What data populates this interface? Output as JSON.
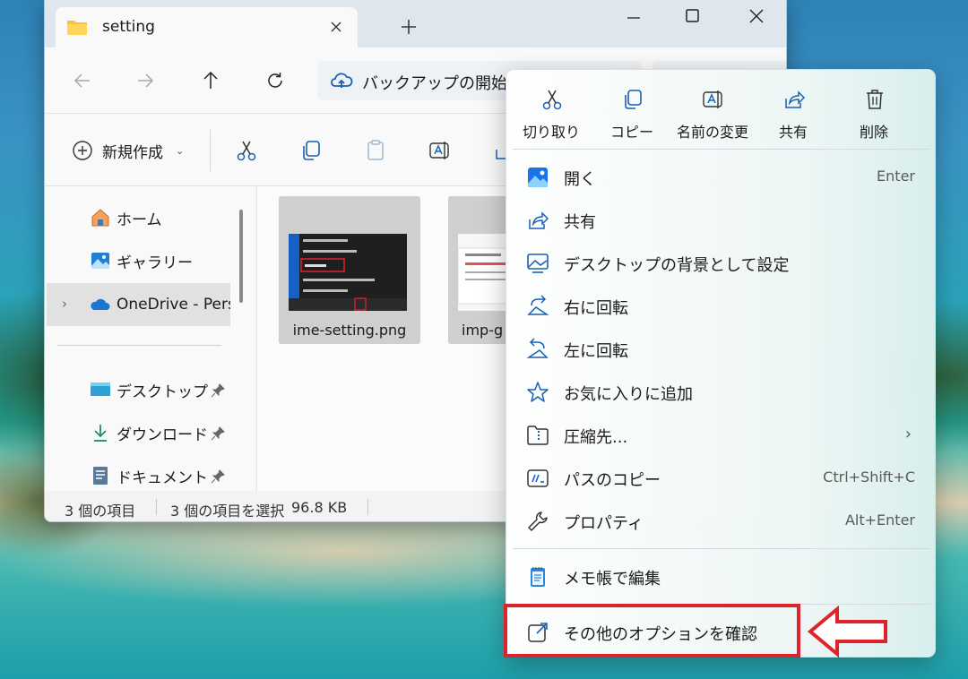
{
  "window": {
    "tab_title": "setting",
    "address": "バックアップの開始"
  },
  "toolbar": {
    "new_label": "新規作成"
  },
  "sidebar": {
    "items": [
      {
        "label": "ホーム",
        "icon": "home-icon"
      },
      {
        "label": "ギャラリー",
        "icon": "gallery-icon"
      },
      {
        "label": "OneDrive - Perso",
        "icon": "onedrive-cloud-icon"
      },
      {
        "label": "デスクトップ",
        "icon": "desktop-folder-icon",
        "pinned": true
      },
      {
        "label": "ダウンロード",
        "icon": "download-icon",
        "pinned": true
      },
      {
        "label": "ドキュメント",
        "icon": "documents-icon",
        "pinned": true
      }
    ]
  },
  "files": [
    {
      "name": "ime-setting.png",
      "selected": true
    },
    {
      "name": "imp-g",
      "selected": true
    }
  ],
  "status": {
    "count": "3 個の項目",
    "selection": "3 個の項目を選択",
    "size": "96.8 KB"
  },
  "context_menu": {
    "quick_actions": [
      {
        "label": "切り取り",
        "icon": "cut-icon"
      },
      {
        "label": "コピー",
        "icon": "copy-icon"
      },
      {
        "label": "名前の変更",
        "icon": "rename-icon"
      },
      {
        "label": "共有",
        "icon": "share-icon"
      },
      {
        "label": "削除",
        "icon": "delete-icon"
      }
    ],
    "items": [
      {
        "label": "開く",
        "shortcut": "Enter",
        "icon": "photos-app-icon"
      },
      {
        "label": "共有",
        "shortcut": "",
        "icon": "share-icon"
      },
      {
        "label": "デスクトップの背景として設定",
        "shortcut": "",
        "icon": "wallpaper-icon"
      },
      {
        "label": "右に回転",
        "shortcut": "",
        "icon": "rotate-right-icon"
      },
      {
        "label": "左に回転",
        "shortcut": "",
        "icon": "rotate-left-icon"
      },
      {
        "label": "お気に入りに追加",
        "shortcut": "",
        "icon": "star-icon"
      },
      {
        "label": "圧縮先...",
        "shortcut": "",
        "icon": "zip-folder-icon",
        "submenu": true
      },
      {
        "label": "パスのコピー",
        "shortcut": "Ctrl+Shift+C",
        "icon": "copy-path-icon"
      },
      {
        "label": "プロパティ",
        "shortcut": "Alt+Enter",
        "icon": "wrench-icon"
      },
      {
        "label": "メモ帳で編集",
        "shortcut": "",
        "icon": "notepad-icon"
      },
      {
        "label": "その他のオプションを確認",
        "shortcut": "",
        "icon": "more-options-icon",
        "highlighted": true
      }
    ]
  },
  "colors": {
    "highlight": "#e0222a",
    "selection": "#cfcfcf",
    "accent_blue": "#0067c0"
  }
}
